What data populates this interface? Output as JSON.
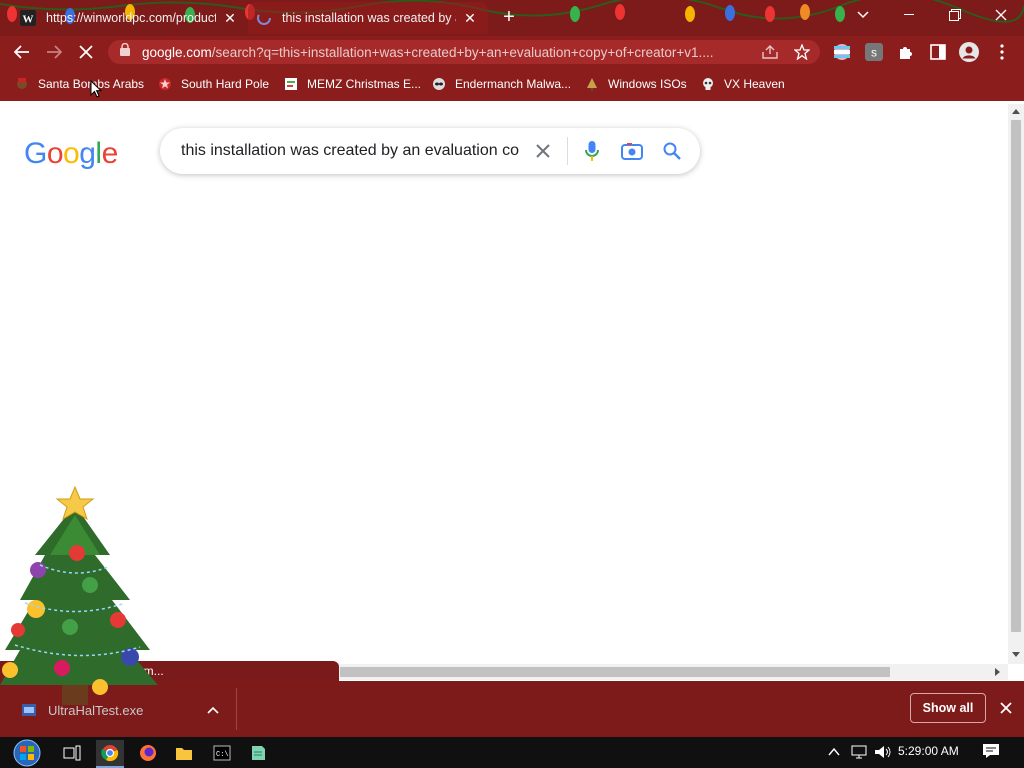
{
  "browser": {
    "tabs": [
      {
        "title": "https://winworldpc.com/product",
        "favicon": "winworld-w-icon",
        "active": false
      },
      {
        "title": "this installation was created by a",
        "favicon": "google-g-icon",
        "active": true
      }
    ],
    "new_tab_label": "+",
    "url": "google.com",
    "url_rest": "/search?q=this+installation+was+created+by+an+evaluation+copy+of+creator+v1....",
    "window_controls": [
      "chevron-down-icon",
      "minimize-icon",
      "restore-icon",
      "close-icon"
    ]
  },
  "bookmarks": [
    {
      "label": "Santa Bombs Arabs",
      "icon": "santa-icon"
    },
    {
      "label": "South Hard Pole",
      "icon": "star-icon"
    },
    {
      "label": "MEMZ Christmas E...",
      "icon": "page-icon"
    },
    {
      "label": "Endermanch Malwa...",
      "icon": "raccoon-icon"
    },
    {
      "label": "Windows ISOs",
      "icon": "tree-icon"
    },
    {
      "label": "VX Heaven",
      "icon": "skull-icon"
    }
  ],
  "google": {
    "logo_letters": [
      "G",
      "o",
      "o",
      "g",
      "l",
      "e"
    ],
    "logo_colors": [
      "#4285f4",
      "#ea4335",
      "#fbbc05",
      "#4285f4",
      "#34a853",
      "#ea4335"
    ],
    "query": "this installation was created by an evaluation copy of creator v1"
  },
  "status": {
    "text": "om..."
  },
  "downloads": {
    "item": "UltraHalTest.exe",
    "show_all": "Show all"
  },
  "taskbar": {
    "clock": "5:29:00 AM",
    "apps": [
      "start-orb-icon",
      "task-view-icon",
      "chrome-icon",
      "firefox-icon",
      "file-explorer-icon",
      "cmd-icon",
      "notepad-icon"
    ]
  },
  "colors": {
    "chrome_frame": "#7d1a1a",
    "toolbar": "#8b1d1d",
    "omnibox": "#a72a2a",
    "google_blue": "#4285f4"
  }
}
